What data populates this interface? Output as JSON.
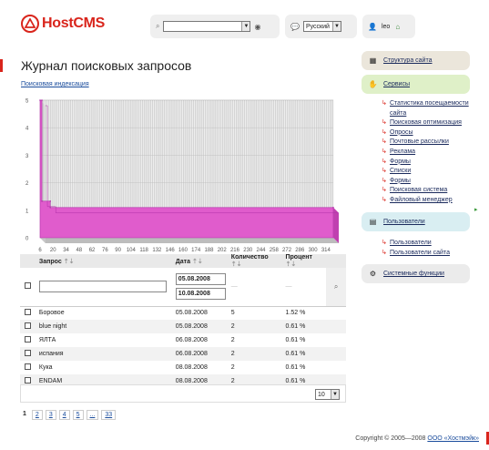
{
  "brand": {
    "name": "HostCMS"
  },
  "header": {
    "search_select": "",
    "language": "Русский",
    "user": "leo"
  },
  "page": {
    "title": "Журнал поисковых запросов",
    "link_indexing": "Поисковая индексация"
  },
  "chart_data": {
    "type": "area",
    "x_ticks": [
      "6",
      "20",
      "34",
      "48",
      "62",
      "76",
      "90",
      "104",
      "118",
      "132",
      "146",
      "160",
      "174",
      "188",
      "202",
      "216",
      "230",
      "244",
      "258",
      "272",
      "286",
      "300",
      "314"
    ],
    "y_ticks": [
      "0",
      "1",
      "2",
      "3",
      "4",
      "5"
    ],
    "ylim": [
      0,
      5
    ],
    "xlim": [
      6,
      322
    ],
    "series": [
      {
        "points": [
          [
            6,
            5
          ],
          [
            8,
            5
          ],
          [
            8,
            1.33
          ],
          [
            17,
            1.33
          ],
          [
            17,
            1.1
          ],
          [
            322,
            1.1
          ]
        ]
      }
    ],
    "colors": {
      "fill": "#e05ccc",
      "stroke": "#b02ea8",
      "bg": "#d4d4d4",
      "grid": "#ffffff"
    }
  },
  "table": {
    "columns": [
      "Запрос",
      "Дата",
      "Количество",
      "Процент"
    ],
    "filter": {
      "query": "",
      "date_from": "05.08.2008",
      "date_to": "10.08.2008",
      "dash": "—"
    },
    "rows": [
      {
        "query": "Боровое",
        "date": "05.08.2008",
        "count": "5",
        "percent": "1.52 %"
      },
      {
        "query": "blue night",
        "date": "05.08.2008",
        "count": "2",
        "percent": "0.61 %"
      },
      {
        "query": "ЯЛТА",
        "date": "06.08.2008",
        "count": "2",
        "percent": "0.61 %"
      },
      {
        "query": "испания",
        "date": "06.08.2008",
        "count": "2",
        "percent": "0.61 %"
      },
      {
        "query": "Кука",
        "date": "08.08.2008",
        "count": "2",
        "percent": "0.61 %"
      },
      {
        "query": "ENDAM",
        "date": "08.08.2008",
        "count": "2",
        "percent": "0.61 %"
      }
    ],
    "per_page": "10"
  },
  "pager": [
    "1",
    "2",
    "3",
    "4",
    "5",
    "...",
    "33"
  ],
  "sidebar": {
    "structure": "Структура сайта",
    "services": "Сервисы",
    "services_items": [
      "Статистика посещаемости сайта",
      "Поисковая оптимизация",
      "Опросы",
      "Почтовые рассылки",
      "Реклама",
      "Формы",
      "Списки",
      "Формы",
      "Поисковая система",
      "Файловый менеджер"
    ],
    "users": "Пользователи",
    "users_items": [
      "Пользователи",
      "Пользователи сайта"
    ],
    "system": "Системные функции"
  },
  "footer": {
    "copyright": "Copyright © 2005—2008",
    "company": "ООО «Хостмэйк»"
  }
}
